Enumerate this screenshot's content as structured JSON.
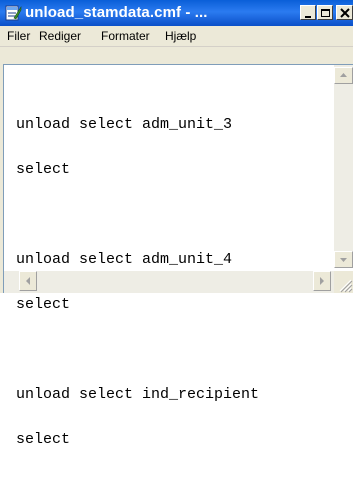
{
  "window": {
    "title": "unload_stamdata.cmf - ...",
    "app_icon": "notepad-icon"
  },
  "titlebar_buttons": [
    "minimize-icon",
    "maximize-icon",
    "close-icon"
  ],
  "menu": {
    "items": [
      {
        "label": "Filer"
      },
      {
        "label": "Rediger"
      },
      {
        "label": "Formater"
      },
      {
        "label": "Hjælp"
      }
    ]
  },
  "editor": {
    "lines": [
      "unload select adm_unit_3",
      "select",
      "",
      "unload select adm_unit_4",
      "select",
      "",
      "unload select ind_recipient",
      "select"
    ]
  },
  "colors": {
    "titlebar": "#0a5fd8",
    "chrome": "#ece9d8",
    "text": "#000000"
  }
}
